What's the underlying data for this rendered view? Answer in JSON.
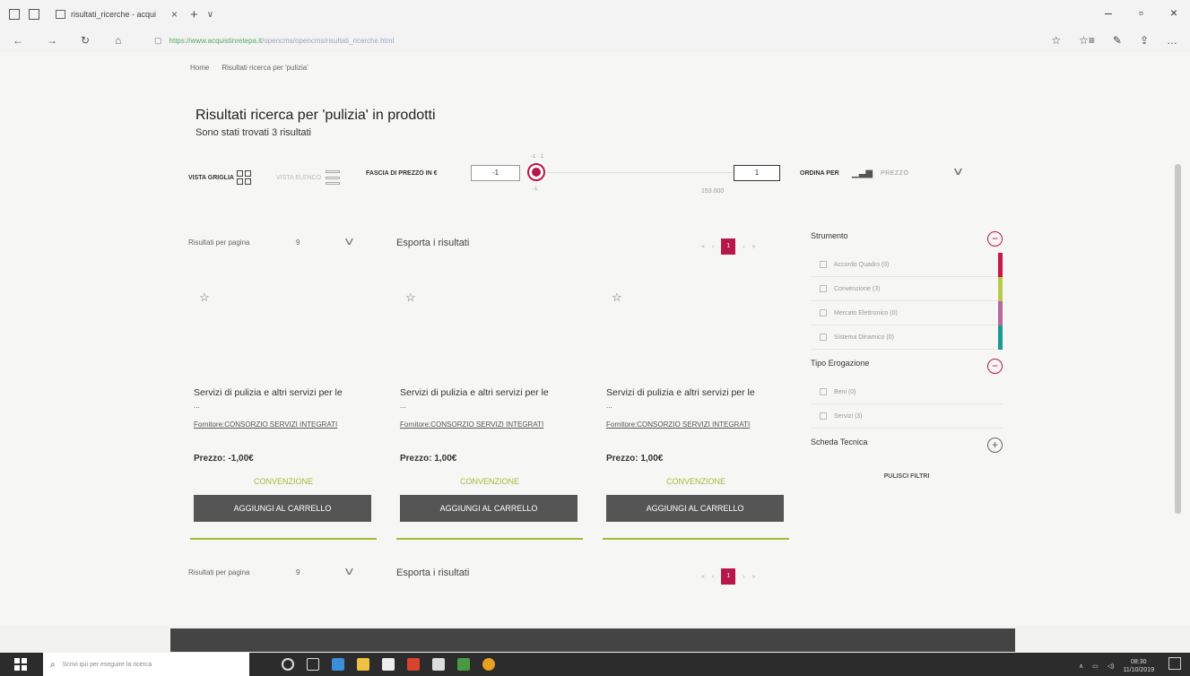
{
  "browser": {
    "tab_title": "risultati_ricerche - acqui",
    "tab_close": "×",
    "new_tab": "+",
    "tab_menu": "∨",
    "url_host": "https://www.acquistinretepa.it",
    "url_path": "/opencms/opencms/risultati_ricerche.html",
    "window_controls": [
      "–",
      "▫",
      "×"
    ]
  },
  "breadcrumb": [
    "Home",
    "Risultati ricerca per 'pulizia'"
  ],
  "heading": {
    "title": "Risultati ricerca per 'pulizia' in prodotti",
    "subtitle": "Sono stati trovati 3 risultati"
  },
  "toolbar": {
    "grid_view": "VISTA GRIGLIA",
    "list_view": "VISTA ELENCO",
    "price_range_label": "FASCIA DI PREZZO IN €",
    "min_value": "-1",
    "slider_top": "-1 · 1",
    "slider_bottom": "-1",
    "max_label": "153.000",
    "max_value": "1",
    "sort_label": "ORDINA PER",
    "sort_value": "PREZZO"
  },
  "pagination": {
    "per_page_label": "Risultati per pagina",
    "per_page_value": "9",
    "export_label": "Esporta i risultati",
    "current_page": "1",
    "first": "«",
    "prev": "‹",
    "next": "›",
    "last": "»"
  },
  "products": [
    {
      "title": "Servizi di pulizia e altri servizi per le",
      "ellipsis": "...",
      "supplier": "Fornitore:CONSORZIO SERVIZI INTEGRATI",
      "price": "Prezzo: -1,00€",
      "type": "CONVENZIONE",
      "cart_label": "AGGIUNGI AL CARRELLO"
    },
    {
      "title": "Servizi di pulizia e altri servizi per le",
      "ellipsis": "...",
      "supplier": "Fornitore:CONSORZIO SERVIZI INTEGRATI",
      "price": "Prezzo: 1,00€",
      "type": "CONVENZIONE",
      "cart_label": "AGGIUNGI AL CARRELLO"
    },
    {
      "title": "Servizi di pulizia e altri servizi per le",
      "ellipsis": "...",
      "supplier": "Fornitore:CONSORZIO SERVIZI INTEGRATI",
      "price": "Prezzo: 1,00€",
      "type": "CONVENZIONE",
      "cart_label": "AGGIUNGI AL CARRELLO"
    }
  ],
  "filters": {
    "strumento": {
      "title": "Strumento",
      "items": [
        {
          "label": "Accordo Quadro (0)",
          "color": "#c8174a"
        },
        {
          "label": "Convenzione (3)",
          "color": "#b7cc44"
        },
        {
          "label": "Mercato Elettronico (0)",
          "color": "#b46a9e"
        },
        {
          "label": "Sistema Dinamico (0)",
          "color": "#1a9a94"
        }
      ]
    },
    "tipo": {
      "title": "Tipo Erogazione",
      "items": [
        {
          "label": "Beni (0)"
        },
        {
          "label": "Servizi (3)"
        }
      ]
    },
    "scheda": {
      "title": "Scheda Tecnica"
    },
    "toggle_minus": "−",
    "toggle_plus": "+",
    "clear_label": "PULISCI FILTRI"
  },
  "taskbar": {
    "search_placeholder": "Scrivi qui per eseguire la ricerca",
    "time": "08:30",
    "date": "11/10/2019"
  },
  "colors": {
    "accent": "#b8174a",
    "convenzione": "#9fbe3a",
    "button": "#555555"
  }
}
